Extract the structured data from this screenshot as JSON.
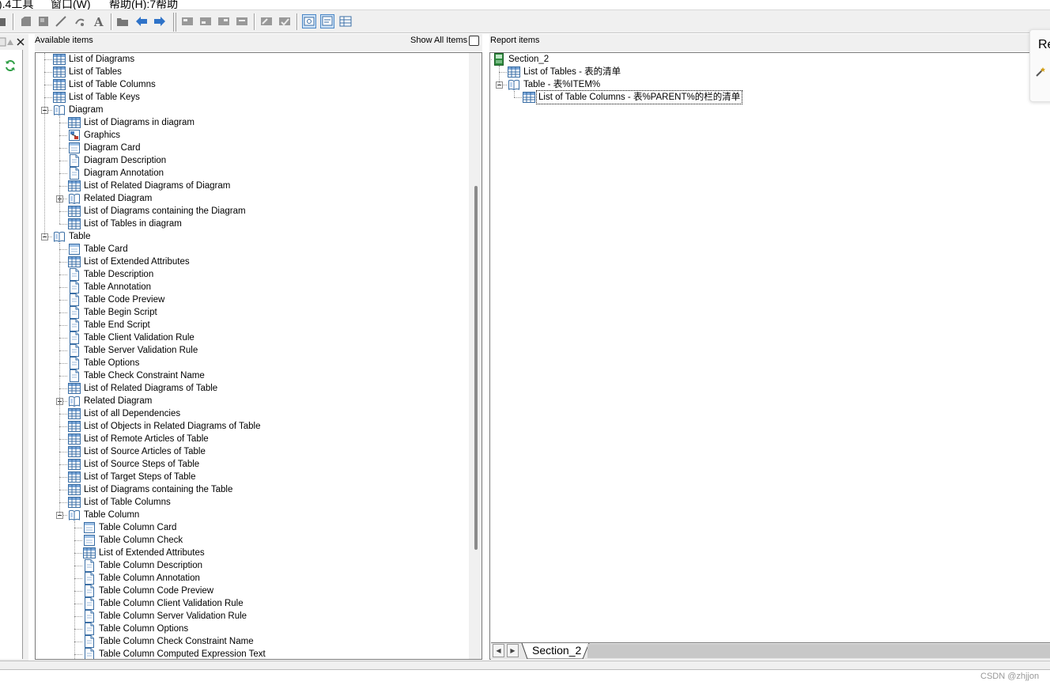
{
  "menu": {
    "tools": ").4工具",
    "window": "窗口(W)",
    "help": "帮助(H):7帮助"
  },
  "available_panel": {
    "title": "Available items",
    "show_all_label": "Show All Items",
    "show_all_checked": false
  },
  "report_panel": {
    "title": "Report items"
  },
  "available_tree": [
    {
      "label": "List of Diagrams",
      "icon": "list-icon",
      "level": 1
    },
    {
      "label": "List of Tables",
      "icon": "list-icon",
      "level": 1
    },
    {
      "label": "List of Table Columns",
      "icon": "list-icon",
      "level": 1
    },
    {
      "label": "List of Table Keys",
      "icon": "list-icon",
      "level": 1
    },
    {
      "label": "Diagram",
      "icon": "book-icon",
      "level": 1,
      "expander": "minus"
    },
    {
      "label": "List of Diagrams in diagram",
      "icon": "list-icon",
      "level": 2
    },
    {
      "label": "Graphics",
      "icon": "graphics-icon",
      "level": 2
    },
    {
      "label": "Diagram Card",
      "icon": "card-icon",
      "level": 2
    },
    {
      "label": "Diagram Description",
      "icon": "doc-icon",
      "level": 2
    },
    {
      "label": "Diagram Annotation",
      "icon": "doc-icon",
      "level": 2
    },
    {
      "label": "List of Related Diagrams of Diagram",
      "icon": "list-icon",
      "level": 2
    },
    {
      "label": "Related Diagram",
      "icon": "book-icon",
      "level": 2,
      "expander": "plus"
    },
    {
      "label": "List of Diagrams containing the Diagram",
      "icon": "list-icon",
      "level": 2
    },
    {
      "label": "List of Tables in diagram",
      "icon": "list-icon",
      "level": 2
    },
    {
      "label": "Table",
      "icon": "book-icon",
      "level": 1,
      "expander": "minus"
    },
    {
      "label": "Table Card",
      "icon": "card-icon",
      "level": 2
    },
    {
      "label": "List of Extended Attributes",
      "icon": "list-icon",
      "level": 2
    },
    {
      "label": "Table Description",
      "icon": "doc-icon",
      "level": 2
    },
    {
      "label": "Table Annotation",
      "icon": "doc-icon",
      "level": 2
    },
    {
      "label": "Table Code Preview",
      "icon": "doc-icon",
      "level": 2
    },
    {
      "label": "Table Begin Script",
      "icon": "doc-icon",
      "level": 2
    },
    {
      "label": "Table End Script",
      "icon": "doc-icon",
      "level": 2
    },
    {
      "label": "Table Client Validation Rule",
      "icon": "doc-icon",
      "level": 2
    },
    {
      "label": "Table Server Validation Rule",
      "icon": "doc-icon",
      "level": 2
    },
    {
      "label": "Table Options",
      "icon": "doc-icon",
      "level": 2
    },
    {
      "label": "Table Check Constraint Name",
      "icon": "doc-icon",
      "level": 2
    },
    {
      "label": "List of Related Diagrams of Table",
      "icon": "list-icon",
      "level": 2
    },
    {
      "label": "Related Diagram",
      "icon": "book-icon",
      "level": 2,
      "expander": "plus"
    },
    {
      "label": "List of all Dependencies",
      "icon": "list-icon",
      "level": 2
    },
    {
      "label": "List of Objects in Related Diagrams of Table",
      "icon": "list-icon",
      "level": 2
    },
    {
      "label": "List of Remote Articles of Table",
      "icon": "list-icon",
      "level": 2
    },
    {
      "label": "List of Source Articles of Table",
      "icon": "list-icon",
      "level": 2
    },
    {
      "label": "List of Source Steps of Table",
      "icon": "list-icon",
      "level": 2
    },
    {
      "label": "List of Target Steps of Table",
      "icon": "list-icon",
      "level": 2
    },
    {
      "label": "List of Diagrams containing the Table",
      "icon": "list-icon",
      "level": 2
    },
    {
      "label": "List of Table Columns",
      "icon": "list-icon",
      "level": 2
    },
    {
      "label": "Table Column",
      "icon": "book-icon",
      "level": 2,
      "expander": "minus"
    },
    {
      "label": "Table Column Card",
      "icon": "card-icon",
      "level": 3
    },
    {
      "label": "Table Column Check",
      "icon": "card-icon",
      "level": 3
    },
    {
      "label": "List of Extended Attributes",
      "icon": "list-icon",
      "level": 3
    },
    {
      "label": "Table Column Description",
      "icon": "doc-icon",
      "level": 3
    },
    {
      "label": "Table Column Annotation",
      "icon": "doc-icon",
      "level": 3
    },
    {
      "label": "Table Column Code Preview",
      "icon": "doc-icon",
      "level": 3
    },
    {
      "label": "Table Column Client Validation Rule",
      "icon": "doc-icon",
      "level": 3
    },
    {
      "label": "Table Column Server Validation Rule",
      "icon": "doc-icon",
      "level": 3
    },
    {
      "label": "Table Column Options",
      "icon": "doc-icon",
      "level": 3
    },
    {
      "label": "Table Column Check Constraint Name",
      "icon": "doc-icon",
      "level": 3
    },
    {
      "label": "Table Column Computed Expression Text",
      "icon": "doc-icon",
      "level": 3
    }
  ],
  "report_tree": [
    {
      "label": "Section_2",
      "icon": "section-icon",
      "level": 0
    },
    {
      "label": "List of Tables - 表的清单",
      "icon": "list-icon",
      "level": 1
    },
    {
      "label": "Table - 表%ITEM%",
      "icon": "book-icon",
      "level": 1,
      "expander": "minus"
    },
    {
      "label": "List of Table Columns - 表%PARENT%的栏的清单",
      "icon": "list-icon",
      "level": 2,
      "selected": true
    }
  ],
  "tabs": {
    "active": "Section_2"
  },
  "popup": {
    "label": "Re"
  },
  "watermark": "CSDN @zhjjon",
  "colors": {
    "list_icon_blue": "#3a6ea5",
    "section_green": "#2e8b3e",
    "chrome_gray": "#f0f0f0"
  }
}
